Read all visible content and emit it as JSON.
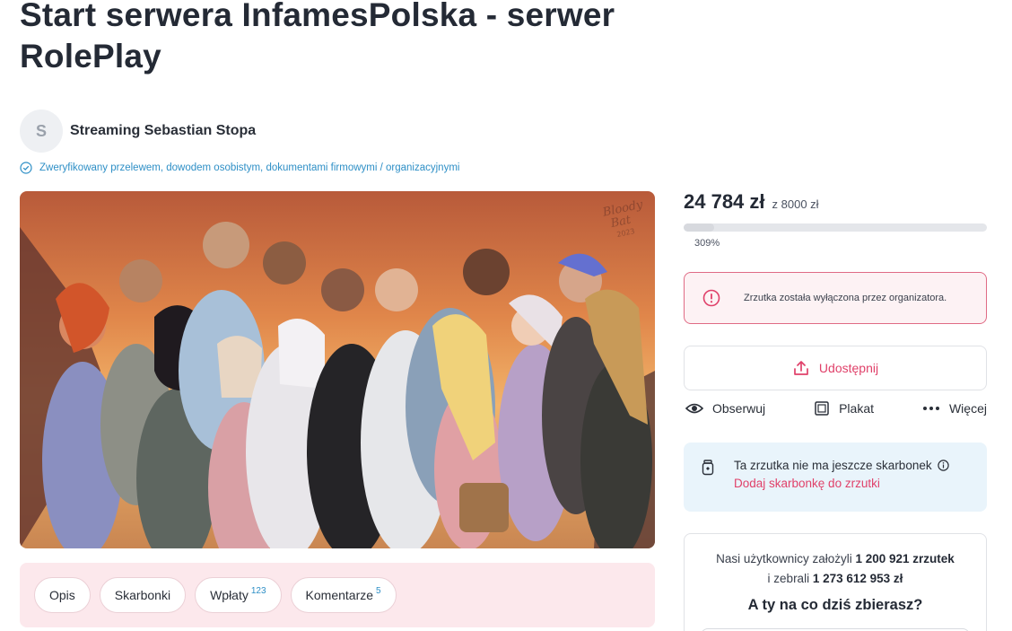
{
  "page": {
    "title": "Start serwera InfamesPolska - serwer RolePlay"
  },
  "author": {
    "initial": "S",
    "name": "Streaming Sebastian Stopa"
  },
  "verification": {
    "text": "Zweryfikowany przelewem, dowodem osobistym, dokumentami firmowymi / organizacyjnymi",
    "icon": "check-circle-icon"
  },
  "hero": {
    "signature": "Bloody Bat 2023"
  },
  "tabs": [
    {
      "label": "Opis",
      "count": ""
    },
    {
      "label": "Skarbonki",
      "count": ""
    },
    {
      "label": "Wpłaty",
      "count": "123"
    },
    {
      "label": "Komentarze",
      "count": "5"
    }
  ],
  "funding": {
    "raised": "24 784 zł",
    "goal": "z 8000 zł",
    "percent": "309%",
    "progress_fraction": 0.1
  },
  "status": {
    "message": "Zrzutka została wyłączona przez organizatora.",
    "icon": "alert-circle-icon"
  },
  "share": {
    "label": "Udostępnij",
    "icon": "share-icon"
  },
  "actions": {
    "follow": "Obserwuj",
    "poster": "Plakat",
    "more": "Więcej"
  },
  "piggybank": {
    "text": "Ta zrzutka nie ma jeszcze skarbonek",
    "link": "Dodaj skarbonkę do zrzutki"
  },
  "stats": {
    "line1_prefix": "Nasi użytkownicy założyli",
    "line1_value": "1 200 921 zrzutek",
    "line2_prefix": "i zebrali",
    "line2_value": "1 273 612 953 zł",
    "question": "A ty na co dziś zbierasz?"
  },
  "colors": {
    "accent": "#e0416a",
    "link_blue": "#2e8fc6",
    "alert_border": "#e06b85",
    "info_bg": "#e9f4fb",
    "tabs_bg": "#fce8ec"
  }
}
